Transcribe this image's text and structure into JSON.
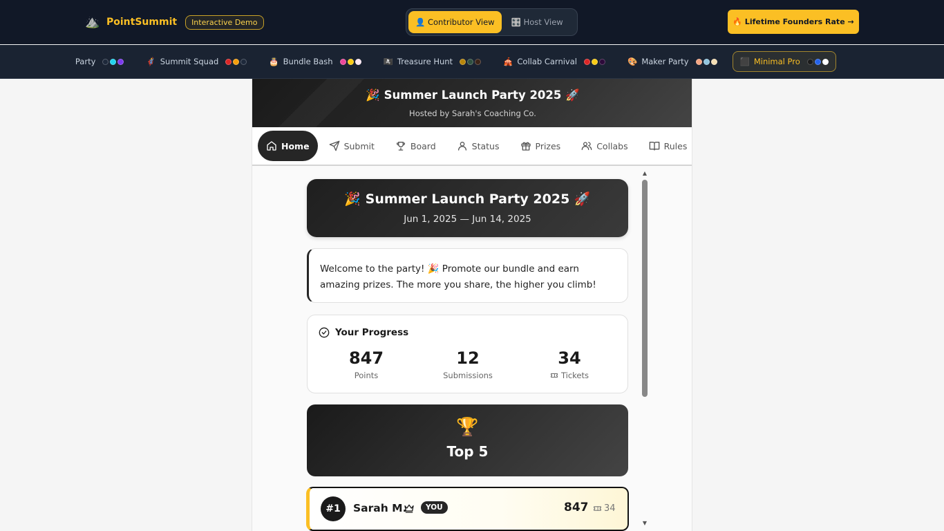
{
  "topbar": {
    "brand_icon": "⛰️",
    "brand_name": "PointSummit",
    "demo_badge": "Interactive Demo",
    "views": [
      {
        "icon": "👤",
        "label": "Contributor View",
        "active": true
      },
      {
        "icon": "🎛️",
        "label": "Host View",
        "active": false
      }
    ],
    "cta": "🔥 Lifetime Founders Rate →"
  },
  "themes": [
    {
      "icon": "",
      "label": "aunch Party",
      "colors": [
        "#1e293b",
        "#22d3ee",
        "#7c3aed"
      ],
      "active": false
    },
    {
      "icon": "🦸",
      "label": "Summit Squad",
      "colors": [
        "#dc2626",
        "#f59e0b",
        "#1e293b"
      ],
      "active": false
    },
    {
      "icon": "🎂",
      "label": "Bundle Bash",
      "colors": [
        "#ec4899",
        "#facc15",
        "#fce7f3"
      ],
      "active": false
    },
    {
      "icon": "🏴‍☠️",
      "label": "Treasure Hunt",
      "colors": [
        "#b8860b",
        "#2f4f3f",
        "#3b2418"
      ],
      "active": false
    },
    {
      "icon": "🎪",
      "label": "Collab Carnival",
      "colors": [
        "#dc2626",
        "#facc15",
        "#2d0a3a"
      ],
      "active": false
    },
    {
      "icon": "🎨",
      "label": "Maker Party",
      "colors": [
        "#f4a582",
        "#92c5de",
        "#f5deb3"
      ],
      "active": false
    },
    {
      "icon": "⬛",
      "label": "Minimal Pro",
      "colors": [
        "#1a1a1a",
        "#2563eb",
        "#ffffff"
      ],
      "active": true
    }
  ],
  "campaign": {
    "banner_title": "🎉 Summer Launch Party 2025 🚀",
    "banner_subtitle": "Hosted by Sarah's Coaching Co."
  },
  "tabs": [
    {
      "icon": "home-icon",
      "label": "Home",
      "active": true
    },
    {
      "icon": "send-icon",
      "label": "Submit",
      "active": false
    },
    {
      "icon": "trophy-icon",
      "label": "Board",
      "active": false
    },
    {
      "icon": "user-icon",
      "label": "Status",
      "active": false
    },
    {
      "icon": "gift-icon",
      "label": "Prizes",
      "active": false
    },
    {
      "icon": "users-icon",
      "label": "Collabs",
      "active": false
    },
    {
      "icon": "book-icon",
      "label": "Rules",
      "active": false
    },
    {
      "icon": "calculator-icon",
      "label": "",
      "active": false
    }
  ],
  "hero": {
    "title": "🎉 Summer Launch Party 2025 🚀",
    "dates": "Jun 1, 2025 — Jun 14, 2025"
  },
  "welcome": "Welcome to the party! 🎉 Promote our bundle and earn amazing prizes. The more you share, the higher you climb!",
  "progress": {
    "heading": "Your Progress",
    "stats": [
      {
        "value": "847",
        "label": "Points"
      },
      {
        "value": "12",
        "label": "Submissions"
      },
      {
        "value": "34",
        "label": "Tickets"
      }
    ]
  },
  "top5": {
    "icon": "🏆",
    "title": "Top 5"
  },
  "leaderboard": [
    {
      "rank": "#1",
      "name": "Sarah M.",
      "badge": "YOU",
      "points": "847",
      "tickets": "34"
    }
  ],
  "colors": {
    "accent": "#fbbf24",
    "topbar_bg": "#111827",
    "dark": "#262626"
  }
}
